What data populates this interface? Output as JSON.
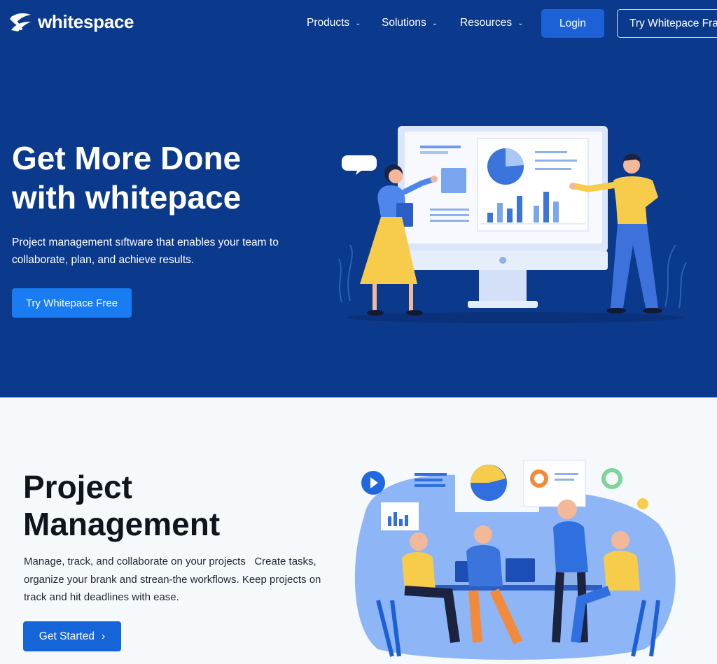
{
  "brand": {
    "name": "whitespace"
  },
  "nav": {
    "items": [
      {
        "label": "Products"
      },
      {
        "label": "Solutions"
      },
      {
        "label": "Resources"
      }
    ],
    "login_label": "Login",
    "try_label": "Try Whitepace Fra"
  },
  "hero": {
    "title_line1": "Get More Done",
    "title_line2": "with whitepace",
    "subtitle": "Project management sıftware that enables your team to collaborate, plan, and achieve results.",
    "cta_label": "Try Whitepace Free",
    "illustration": "presentation-monitor-illustration"
  },
  "section2": {
    "title_line1": "Project",
    "title_line2": "Management",
    "body": "Manage, track, and collaborate on your projects   Create tasks, organize your brank and strean-the workflows. Keep projects on track and hit deadlines with ease.",
    "cta_label": "Get Started",
    "illustration": "team-meeting-illustration"
  },
  "colors": {
    "hero_bg": "#0b3a8c",
    "primary_button": "#1a7cf2",
    "login_button": "#1d61d6",
    "get_started_button": "#1565d8",
    "section_bg": "#f6f9fc",
    "accent_yellow": "#f7cc4a"
  }
}
